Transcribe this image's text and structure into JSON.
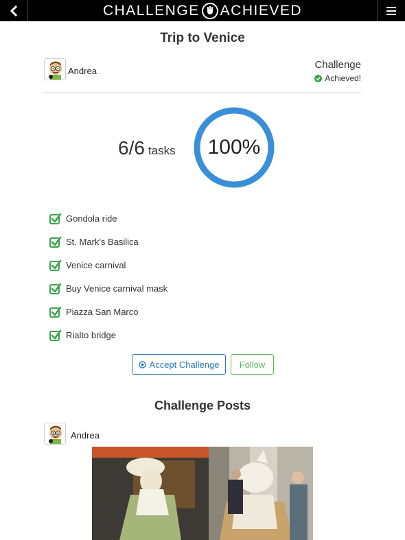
{
  "header": {
    "brand_left": "CHALLENGE",
    "brand_right": "ACHIEVED",
    "back_icon": "chevron-left-icon",
    "menu_icon": "hamburger-menu-icon"
  },
  "challenge": {
    "title": "Trip to Venice",
    "author": "Andrea",
    "type_label": "Challenge",
    "status": "Achieved!",
    "tasks_done": "6/6",
    "tasks_word": "tasks",
    "progress_label": "100%",
    "progress_fraction": 1.0
  },
  "tasks": [
    {
      "label": "Gondola ride",
      "done": true
    },
    {
      "label": "St. Mark's Basilica",
      "done": true
    },
    {
      "label": "Venice carnival",
      "done": true
    },
    {
      "label": "Buy Venice carnival mask",
      "done": true
    },
    {
      "label": "Piazza San Marco",
      "done": true
    },
    {
      "label": "Rialto bridge",
      "done": true
    }
  ],
  "actions": {
    "accept_label": "Accept Challenge",
    "follow_label": "Follow"
  },
  "posts": {
    "section_title": "Challenge Posts",
    "items": [
      {
        "author": "Andrea"
      }
    ]
  },
  "colors": {
    "topbar": "#000000",
    "accent_blue": "#2b7bb9",
    "ring_blue": "#3a8fd9",
    "success_green": "#5cb85c",
    "check_green": "#3aa54a"
  }
}
